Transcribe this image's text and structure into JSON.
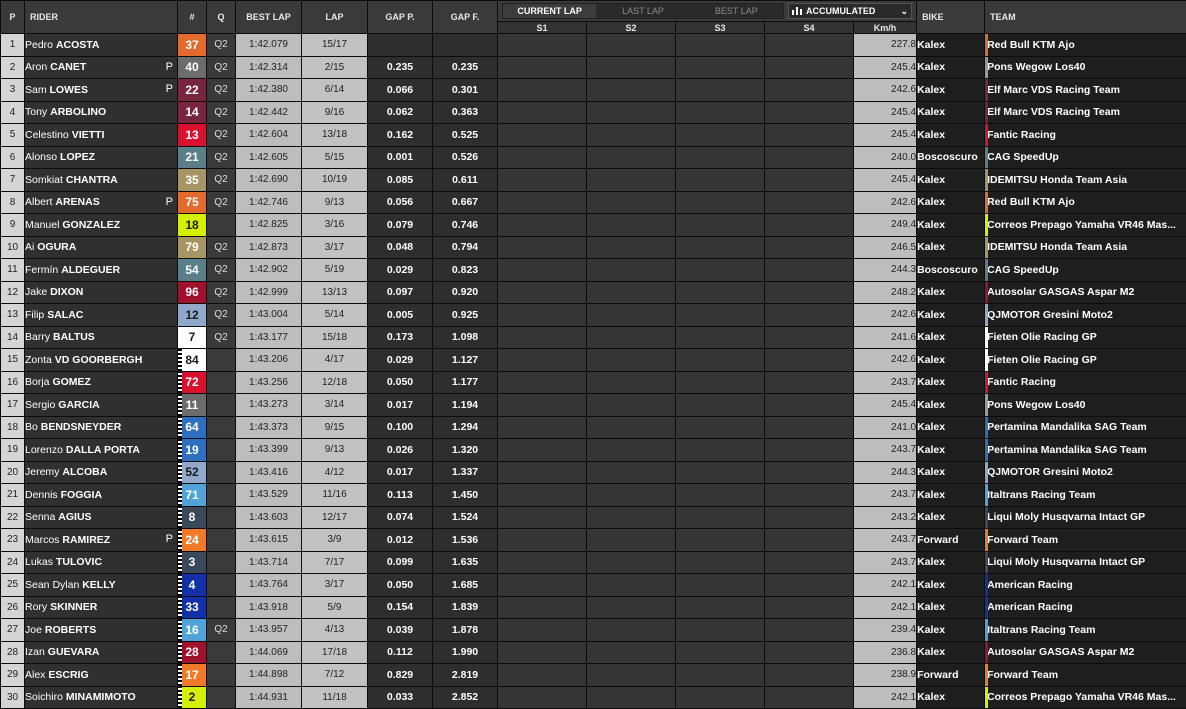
{
  "headers": {
    "p": "P",
    "rider": "RIDER",
    "num": "#",
    "q": "Q",
    "best_lap": "BEST LAP",
    "lap": "LAP",
    "gap_p": "GAP P.",
    "gap_f": "GAP F.",
    "bike": "BIKE",
    "team": "TEAM",
    "s1": "S1",
    "s2": "S2",
    "s3": "S3",
    "s4": "S4",
    "kmh": "Km/h"
  },
  "sector_tabs": {
    "current_lap": "CURRENT LAP",
    "last_lap": "LAST LAP",
    "best_lap": "BEST LAP",
    "active": "current_lap"
  },
  "accumulated": {
    "icon": "bar-chart-icon",
    "label": "ACCUMULATED"
  },
  "rows": [
    {
      "pos": "1",
      "first": "Pedro",
      "last": "ACOSTA",
      "flag": "",
      "num": "37",
      "num_bg": "#e26a2c",
      "num_fg": "#ffffff",
      "q": "Q2",
      "best": "1:42.079",
      "lap": "15/17",
      "gap_p": "",
      "gap_f": "",
      "kmh": "227.8",
      "bike": "Kalex",
      "team": "Red Bull KTM Ajo",
      "team_color": "#e26a2c"
    },
    {
      "pos": "2",
      "first": "Aron",
      "last": "CANET",
      "flag": "P",
      "num": "40",
      "num_bg": "#6c6c6c",
      "num_fg": "#ffffff",
      "q": "Q2",
      "best": "1:42.314",
      "lap": "2/15",
      "gap_p": "0.235",
      "gap_f": "0.235",
      "kmh": "245.4",
      "bike": "Kalex",
      "team": "Pons Wegow Los40",
      "team_color": "#9a9a9a"
    },
    {
      "pos": "3",
      "first": "Sam",
      "last": "LOWES",
      "flag": "P",
      "num": "22",
      "num_bg": "#7a2540",
      "num_fg": "#ffffff",
      "q": "Q2",
      "best": "1:42.380",
      "lap": "6/14",
      "gap_p": "0.066",
      "gap_f": "0.301",
      "kmh": "242.6",
      "bike": "Kalex",
      "team": "Elf Marc VDS Racing Team",
      "team_color": "#7a2540"
    },
    {
      "pos": "4",
      "first": "Tony",
      "last": "ARBOLINO",
      "flag": "",
      "num": "14",
      "num_bg": "#7a2540",
      "num_fg": "#ffffff",
      "q": "Q2",
      "best": "1:42.442",
      "lap": "9/16",
      "gap_p": "0.062",
      "gap_f": "0.363",
      "kmh": "245.4",
      "bike": "Kalex",
      "team": "Elf Marc VDS Racing Team",
      "team_color": "#7a2540"
    },
    {
      "pos": "5",
      "first": "Celestino",
      "last": "VIETTI",
      "flag": "",
      "num": "13",
      "num_bg": "#d9112f",
      "num_fg": "#ffffff",
      "q": "Q2",
      "best": "1:42.604",
      "lap": "13/18",
      "gap_p": "0.162",
      "gap_f": "0.525",
      "kmh": "245.4",
      "bike": "Kalex",
      "team": "Fantic Racing",
      "team_color": "#d9112f"
    },
    {
      "pos": "6",
      "first": "Alonso",
      "last": "LOPEZ",
      "flag": "",
      "num": "21",
      "num_bg": "#5a7f88",
      "num_fg": "#ffffff",
      "q": "Q2",
      "best": "1:42.605",
      "lap": "5/15",
      "gap_p": "0.001",
      "gap_f": "0.526",
      "kmh": "240.0",
      "bike": "Boscoscuro",
      "team": "CAG SpeedUp",
      "team_color": "#5a7f88"
    },
    {
      "pos": "7",
      "first": "Somkiat",
      "last": "CHANTRA",
      "flag": "",
      "num": "35",
      "num_bg": "#a89564",
      "num_fg": "#ffffff",
      "q": "Q2",
      "best": "1:42.690",
      "lap": "10/19",
      "gap_p": "0.085",
      "gap_f": "0.611",
      "kmh": "245.4",
      "bike": "Kalex",
      "team": "IDEMITSU Honda Team Asia",
      "team_color": "#a89564"
    },
    {
      "pos": "8",
      "first": "Albert",
      "last": "ARENAS",
      "flag": "P",
      "num": "75",
      "num_bg": "#e26a2c",
      "num_fg": "#ffffff",
      "q": "Q2",
      "best": "1:42.746",
      "lap": "9/13",
      "gap_p": "0.056",
      "gap_f": "0.667",
      "kmh": "242.6",
      "bike": "Kalex",
      "team": "Red Bull KTM Ajo",
      "team_color": "#e26a2c"
    },
    {
      "pos": "9",
      "first": "Manuel",
      "last": "GONZALEZ",
      "flag": "",
      "num": "18",
      "num_bg": "#d4f000",
      "num_fg": "#1a1a1a",
      "q": "",
      "best": "1:42.825",
      "lap": "3/16",
      "gap_p": "0.079",
      "gap_f": "0.746",
      "kmh": "249.4",
      "bike": "Kalex",
      "team": "Correos Prepago Yamaha VR46 Mas...",
      "team_color": "#d4f000"
    },
    {
      "pos": "10",
      "first": "Ai",
      "last": "OGURA",
      "flag": "",
      "num": "79",
      "num_bg": "#a89564",
      "num_fg": "#ffffff",
      "q": "Q2",
      "best": "1:42.873",
      "lap": "3/17",
      "gap_p": "0.048",
      "gap_f": "0.794",
      "kmh": "246.5",
      "bike": "Kalex",
      "team": "IDEMITSU Honda Team Asia",
      "team_color": "#a89564"
    },
    {
      "pos": "11",
      "first": "Fermín",
      "last": "ALDEGUER",
      "flag": "",
      "num": "54",
      "num_bg": "#5a7f88",
      "num_fg": "#ffffff",
      "q": "Q2",
      "best": "1:42.902",
      "lap": "5/19",
      "gap_p": "0.029",
      "gap_f": "0.823",
      "kmh": "244.3",
      "bike": "Boscoscuro",
      "team": "CAG SpeedUp",
      "team_color": "#5a7f88"
    },
    {
      "pos": "12",
      "first": "Jake",
      "last": "DIXON",
      "flag": "",
      "num": "96",
      "num_bg": "#a0122c",
      "num_fg": "#ffffff",
      "q": "Q2",
      "best": "1:42.999",
      "lap": "13/13",
      "gap_p": "0.097",
      "gap_f": "0.920",
      "kmh": "248.2",
      "bike": "Kalex",
      "team": "Autosolar GASGAS Aspar M2",
      "team_color": "#a0122c"
    },
    {
      "pos": "13",
      "first": "Filip",
      "last": "SALAC",
      "flag": "",
      "num": "12",
      "num_bg": "#8fa8cc",
      "num_fg": "#1a1a1a",
      "q": "Q2",
      "best": "1:43.004",
      "lap": "5/14",
      "gap_p": "0.005",
      "gap_f": "0.925",
      "kmh": "242.6",
      "bike": "Kalex",
      "team": "QJMOTOR Gresini Moto2",
      "team_color": "#8fa8cc"
    },
    {
      "pos": "14",
      "first": "Barry",
      "last": "BALTUS",
      "flag": "",
      "num": "7",
      "num_bg": "#ffffff",
      "num_fg": "#1a1a1a",
      "q": "Q2",
      "best": "1:43.177",
      "lap": "15/18",
      "gap_p": "0.173",
      "gap_f": "1.098",
      "kmh": "241.6",
      "bike": "Kalex",
      "team": "Fieten Olie Racing GP",
      "team_color": "#ffffff"
    },
    {
      "pos": "15",
      "first": "Zonta",
      "last": "VD GOORBERGH",
      "flag": "",
      "num": "84",
      "num_bg": "#ffffff",
      "num_fg": "#1a1a1a",
      "q": "",
      "best": "1:43.206",
      "lap": "4/17",
      "gap_p": "0.029",
      "gap_f": "1.127",
      "kmh": "242.6",
      "bike": "Kalex",
      "team": "Fieten Olie Racing GP",
      "team_color": "#ffffff"
    },
    {
      "pos": "16",
      "first": "Borja",
      "last": "GOMEZ",
      "flag": "",
      "num": "72",
      "num_bg": "#d9112f",
      "num_fg": "#ffffff",
      "q": "",
      "best": "1:43.256",
      "lap": "12/18",
      "gap_p": "0.050",
      "gap_f": "1.177",
      "kmh": "243.7",
      "bike": "Kalex",
      "team": "Fantic Racing",
      "team_color": "#d9112f"
    },
    {
      "pos": "17",
      "first": "Sergio",
      "last": "GARCIA",
      "flag": "",
      "num": "11",
      "num_bg": "#6c6c6c",
      "num_fg": "#ffffff",
      "q": "",
      "best": "1:43.273",
      "lap": "3/14",
      "gap_p": "0.017",
      "gap_f": "1.194",
      "kmh": "245.4",
      "bike": "Kalex",
      "team": "Pons Wegow Los40",
      "team_color": "#9a9a9a"
    },
    {
      "pos": "18",
      "first": "Bo",
      "last": "BENDSNEYDER",
      "flag": "",
      "num": "64",
      "num_bg": "#2f6fbf",
      "num_fg": "#ffffff",
      "q": "",
      "best": "1:43.373",
      "lap": "9/15",
      "gap_p": "0.100",
      "gap_f": "1.294",
      "kmh": "241.0",
      "bike": "Kalex",
      "team": "Pertamina Mandalika SAG Team",
      "team_color": "#2f6fbf"
    },
    {
      "pos": "19",
      "first": "Lorenzo",
      "last": "DALLA PORTA",
      "flag": "",
      "num": "19",
      "num_bg": "#2f6fbf",
      "num_fg": "#ffffff",
      "q": "",
      "best": "1:43.399",
      "lap": "9/13",
      "gap_p": "0.026",
      "gap_f": "1.320",
      "kmh": "243.7",
      "bike": "Kalex",
      "team": "Pertamina Mandalika SAG Team",
      "team_color": "#2f6fbf"
    },
    {
      "pos": "20",
      "first": "Jeremy",
      "last": "ALCOBA",
      "flag": "",
      "num": "52",
      "num_bg": "#8fa8cc",
      "num_fg": "#1a1a1a",
      "q": "",
      "best": "1:43.416",
      "lap": "4/12",
      "gap_p": "0.017",
      "gap_f": "1.337",
      "kmh": "244.3",
      "bike": "Kalex",
      "team": "QJMOTOR Gresini Moto2",
      "team_color": "#8fa8cc"
    },
    {
      "pos": "21",
      "first": "Dennis",
      "last": "FOGGIA",
      "flag": "",
      "num": "71",
      "num_bg": "#4fa3d8",
      "num_fg": "#ffffff",
      "q": "",
      "best": "1:43.529",
      "lap": "11/16",
      "gap_p": "0.113",
      "gap_f": "1.450",
      "kmh": "243.7",
      "bike": "Kalex",
      "team": "Italtrans Racing Team",
      "team_color": "#4fa3d8"
    },
    {
      "pos": "22",
      "first": "Senna",
      "last": "AGIUS",
      "flag": "",
      "num": "8",
      "num_bg": "#3b4a5a",
      "num_fg": "#ffffff",
      "q": "",
      "best": "1:43.603",
      "lap": "12/17",
      "gap_p": "0.074",
      "gap_f": "1.524",
      "kmh": "243.2",
      "bike": "Kalex",
      "team": "Liqui Moly Husqvarna Intact GP",
      "team_color": "#3b4a5a"
    },
    {
      "pos": "23",
      "first": "Marcos",
      "last": "RAMIREZ",
      "flag": "P",
      "num": "24",
      "num_bg": "#f07a2a",
      "num_fg": "#ffffff",
      "q": "",
      "best": "1:43.615",
      "lap": "3/9",
      "gap_p": "0.012",
      "gap_f": "1.536",
      "kmh": "243.7",
      "bike": "Forward",
      "team": "Forward Team",
      "team_color": "#f07a2a"
    },
    {
      "pos": "24",
      "first": "Lukas",
      "last": "TULOVIC",
      "flag": "",
      "num": "3",
      "num_bg": "#3b4a5a",
      "num_fg": "#ffffff",
      "q": "",
      "best": "1:43.714",
      "lap": "7/17",
      "gap_p": "0.099",
      "gap_f": "1.635",
      "kmh": "243.7",
      "bike": "Kalex",
      "team": "Liqui Moly Husqvarna Intact GP",
      "team_color": "#3b4a5a"
    },
    {
      "pos": "25",
      "first": "Sean Dylan",
      "last": "KELLY",
      "flag": "",
      "num": "4",
      "num_bg": "#1230a8",
      "num_fg": "#ffffff",
      "q": "",
      "best": "1:43.764",
      "lap": "3/17",
      "gap_p": "0.050",
      "gap_f": "1.685",
      "kmh": "242.1",
      "bike": "Kalex",
      "team": "American Racing",
      "team_color": "#1230a8"
    },
    {
      "pos": "26",
      "first": "Rory",
      "last": "SKINNER",
      "flag": "",
      "num": "33",
      "num_bg": "#1230a8",
      "num_fg": "#ffffff",
      "q": "",
      "best": "1:43.918",
      "lap": "5/9",
      "gap_p": "0.154",
      "gap_f": "1.839",
      "kmh": "242.1",
      "bike": "Kalex",
      "team": "American Racing",
      "team_color": "#1230a8"
    },
    {
      "pos": "27",
      "first": "Joe",
      "last": "ROBERTS",
      "flag": "",
      "num": "16",
      "num_bg": "#4fa3d8",
      "num_fg": "#ffffff",
      "q": "Q2",
      "best": "1:43.957",
      "lap": "4/13",
      "gap_p": "0.039",
      "gap_f": "1.878",
      "kmh": "239.4",
      "bike": "Kalex",
      "team": "Italtrans Racing Team",
      "team_color": "#4fa3d8"
    },
    {
      "pos": "28",
      "first": "Izan",
      "last": "GUEVARA",
      "flag": "",
      "num": "28",
      "num_bg": "#a0122c",
      "num_fg": "#ffffff",
      "q": "",
      "best": "1:44.069",
      "lap": "17/18",
      "gap_p": "0.112",
      "gap_f": "1.990",
      "kmh": "236.8",
      "bike": "Kalex",
      "team": "Autosolar GASGAS Aspar M2",
      "team_color": "#a0122c"
    },
    {
      "pos": "29",
      "first": "Alex",
      "last": "ESCRIG",
      "flag": "",
      "num": "17",
      "num_bg": "#f07a2a",
      "num_fg": "#ffffff",
      "q": "",
      "best": "1:44.898",
      "lap": "7/12",
      "gap_p": "0.829",
      "gap_f": "2.819",
      "kmh": "238.9",
      "bike": "Forward",
      "team": "Forward Team",
      "team_color": "#f07a2a"
    },
    {
      "pos": "30",
      "first": "Soichiro",
      "last": "MINAMIMOTO",
      "flag": "",
      "num": "2",
      "num_bg": "#d4f000",
      "num_fg": "#1a1a1a",
      "q": "",
      "best": "1:44.931",
      "lap": "11/18",
      "gap_p": "0.033",
      "gap_f": "2.852",
      "kmh": "242.1",
      "bike": "Kalex",
      "team": "Correos Prepago Yamaha VR46 Mas...",
      "team_color": "#d4f000"
    }
  ]
}
